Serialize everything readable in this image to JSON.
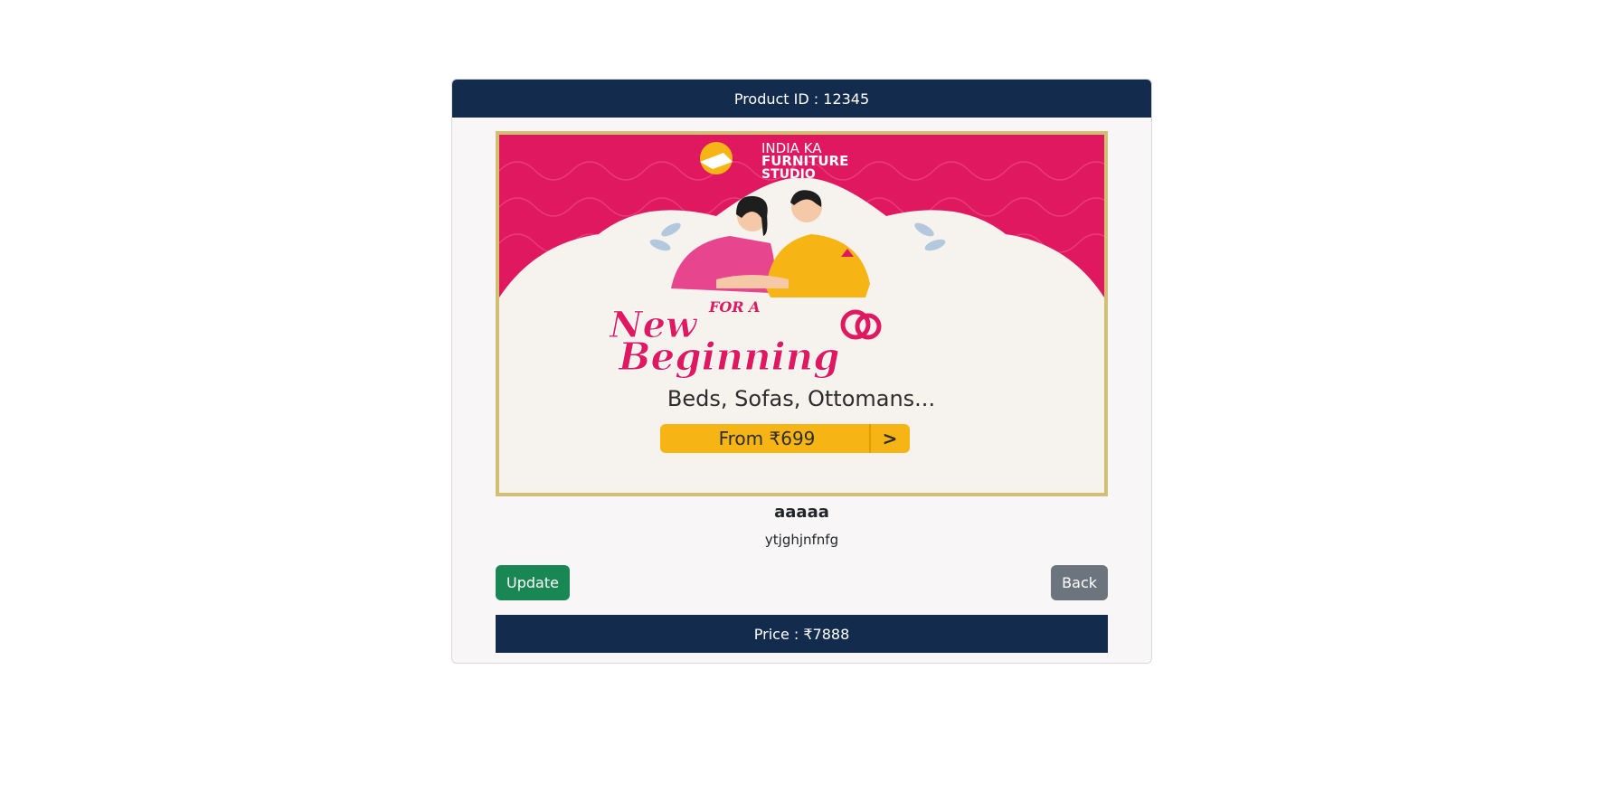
{
  "product": {
    "id_label": "Product ID : 12345",
    "name": "aaaaa",
    "description": "ytjghjnfnfg",
    "price_label": "Price : ₹7888"
  },
  "banner": {
    "brand_line1": "INDIA KA",
    "brand_line2": "FURNITURE",
    "brand_line3": "STUDIO",
    "tagline_small": "FOR A",
    "tagline_line1": "New",
    "tagline_line2": "Beginning",
    "categories": "Beds, Sofas, Ottomans...",
    "offer": "From ₹699",
    "offer_arrow": ">",
    "colors": {
      "magenta": "#e0185f",
      "gold": "#f7b515",
      "border": "#d2bf73"
    }
  },
  "actions": {
    "update_label": "Update",
    "back_label": "Back"
  },
  "colors": {
    "header_bg": "#132b4c",
    "update": "#198754",
    "back": "#6c757d"
  }
}
